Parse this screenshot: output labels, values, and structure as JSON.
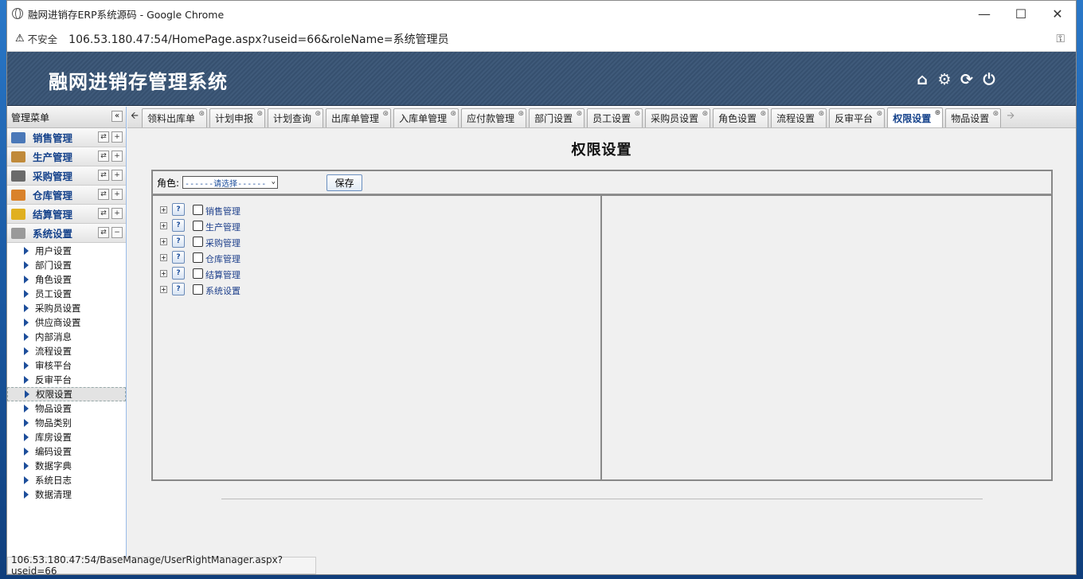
{
  "browser": {
    "window_title": "融网进销存ERP系统源码 - Google Chrome",
    "insecure_label": "不安全",
    "url": "106.53.180.47:54/HomePage.aspx?useid=66&roleName=系统管理员",
    "status_url": "106.53.180.47:54/BaseManage/UserRightManager.aspx?useid=66"
  },
  "app": {
    "title": "融网进销存管理系统",
    "header_icons": [
      "home-icon",
      "gear-icon",
      "refresh-icon",
      "power-icon"
    ]
  },
  "sidebar": {
    "heading": "管理菜单",
    "collapse_glyph": "«",
    "modules": [
      {
        "label": "销售管理",
        "color": "#4a78b8",
        "expanded": false
      },
      {
        "label": "生产管理",
        "color": "#c08a3a",
        "expanded": false
      },
      {
        "label": "采购管理",
        "color": "#6a6a6a",
        "expanded": false
      },
      {
        "label": "仓库管理",
        "color": "#d9822b",
        "expanded": false
      },
      {
        "label": "结算管理",
        "color": "#e0b020",
        "expanded": false
      },
      {
        "label": "系统设置",
        "color": "#9a9a9a",
        "expanded": true
      }
    ],
    "submenu": [
      "用户设置",
      "部门设置",
      "角色设置",
      "员工设置",
      "采购员设置",
      "供应商设置",
      "内部消息",
      "流程设置",
      "审核平台",
      "反审平台",
      "权限设置",
      "物品设置",
      "物品类别",
      "库房设置",
      "编码设置",
      "数据字典",
      "系统日志",
      "数据清理"
    ],
    "active_submenu": "权限设置"
  },
  "tabs": [
    {
      "label": "领料出库单",
      "active": false
    },
    {
      "label": "计划申报",
      "active": false
    },
    {
      "label": "计划查询",
      "active": false
    },
    {
      "label": "出库单管理",
      "active": false
    },
    {
      "label": "入库单管理",
      "active": false
    },
    {
      "label": "应付款管理",
      "active": false
    },
    {
      "label": "部门设置",
      "active": false
    },
    {
      "label": "员工设置",
      "active": false
    },
    {
      "label": "采购员设置",
      "active": false
    },
    {
      "label": "角色设置",
      "active": false
    },
    {
      "label": "流程设置",
      "active": false
    },
    {
      "label": "反审平台",
      "active": false
    },
    {
      "label": "权限设置",
      "active": true
    },
    {
      "label": "物品设置",
      "active": false
    }
  ],
  "page": {
    "title": "权限设置",
    "role_label": "角色:",
    "role_select_value": "------请选择------",
    "save_label": "保存",
    "tree": [
      {
        "label": "销售管理",
        "checked": false
      },
      {
        "label": "生产管理",
        "checked": false
      },
      {
        "label": "采购管理",
        "checked": false
      },
      {
        "label": "仓库管理",
        "checked": false
      },
      {
        "label": "结算管理",
        "checked": false
      },
      {
        "label": "系统设置",
        "checked": false
      }
    ]
  }
}
